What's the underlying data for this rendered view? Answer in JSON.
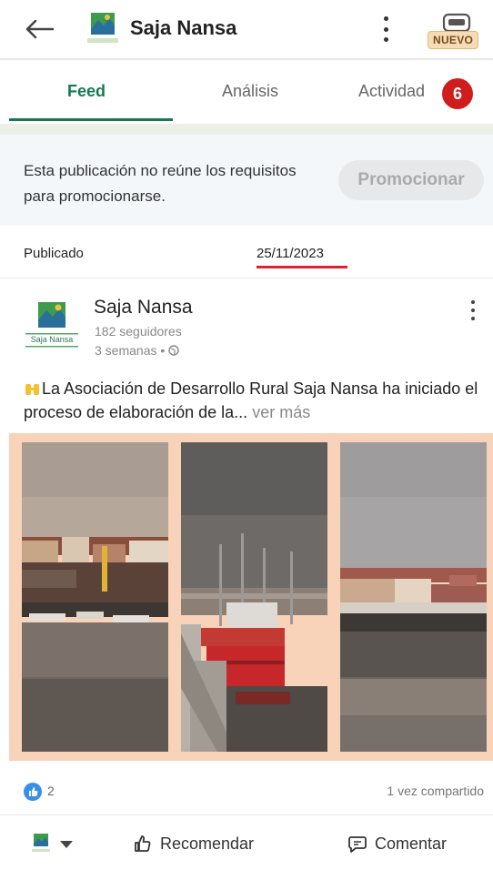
{
  "header": {
    "title": "Saja Nansa",
    "nuevo_badge": "NUEVO"
  },
  "tabs": [
    {
      "label": "Feed",
      "active": true
    },
    {
      "label": "Análisis",
      "active": false
    },
    {
      "label": "Actividad",
      "active": false,
      "count": "6"
    }
  ],
  "promo": {
    "notice": "Esta publicación no reúne los requisitos para promocionarse.",
    "button_label": "Promocionar"
  },
  "published": {
    "label": "Publicado",
    "date": "25/11/2023"
  },
  "post": {
    "author": "Saja Nansa",
    "followers": "182 seguidores",
    "time": "3 semanas •",
    "text": "La Asociación de Desarrollo Rural Saja Nansa ha iniciado el proceso de elaboración de la...",
    "see_more": "ver más",
    "logo_text": "Saja Nansa",
    "reactions": "2",
    "shares": "1 vez compartido"
  },
  "actions": {
    "recommend_label": "Recomendar",
    "comment_label": "Comentar"
  },
  "colors": {
    "accent_green": "#157a52",
    "badge_red": "#d01c1c",
    "like_blue": "#378fe9",
    "gallery_bg": "#f8d2b9"
  }
}
